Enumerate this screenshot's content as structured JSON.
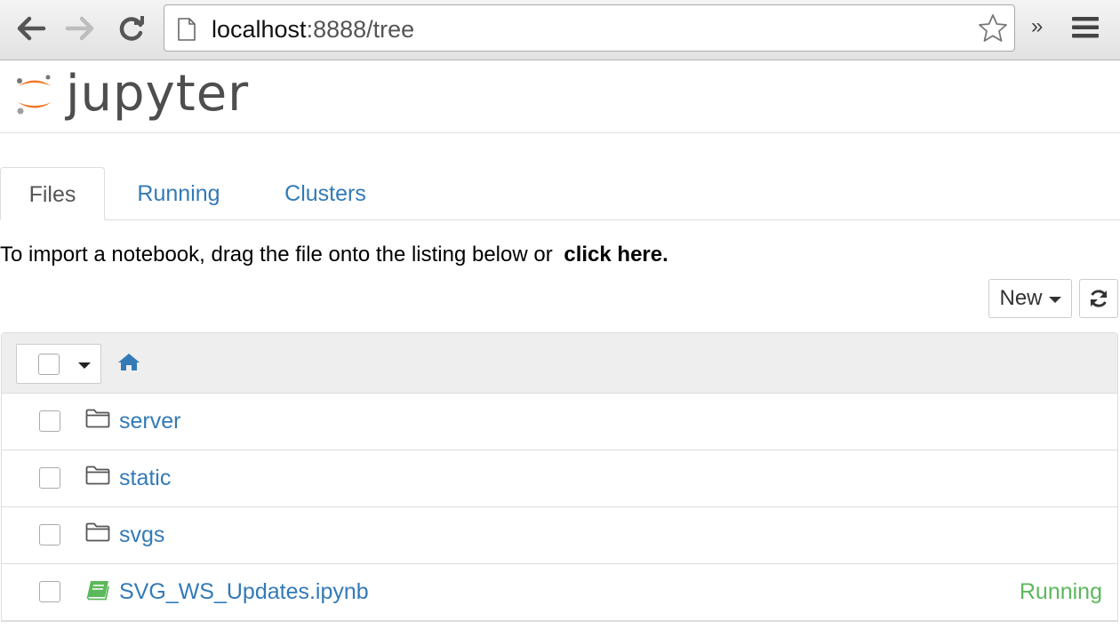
{
  "browser": {
    "url_host": "localhost",
    "url_path": ":8888/tree",
    "overflow_label": "»"
  },
  "header": {
    "logo_text": "jupyter"
  },
  "tabs": [
    {
      "label": "Files",
      "active": true
    },
    {
      "label": "Running",
      "active": false
    },
    {
      "label": "Clusters",
      "active": false
    }
  ],
  "import": {
    "text": "To import a notebook, drag the file onto the listing below or",
    "link": "click here."
  },
  "toolbar": {
    "new_label": "New"
  },
  "files": [
    {
      "name": "server",
      "type": "folder",
      "status": ""
    },
    {
      "name": "static",
      "type": "folder",
      "status": ""
    },
    {
      "name": "svgs",
      "type": "folder",
      "status": ""
    },
    {
      "name": "SVG_WS_Updates.ipynb",
      "type": "notebook",
      "status": "Running"
    }
  ],
  "colors": {
    "link": "#337ab7",
    "running": "#5cb85c",
    "logo_orange": "#f37726"
  }
}
